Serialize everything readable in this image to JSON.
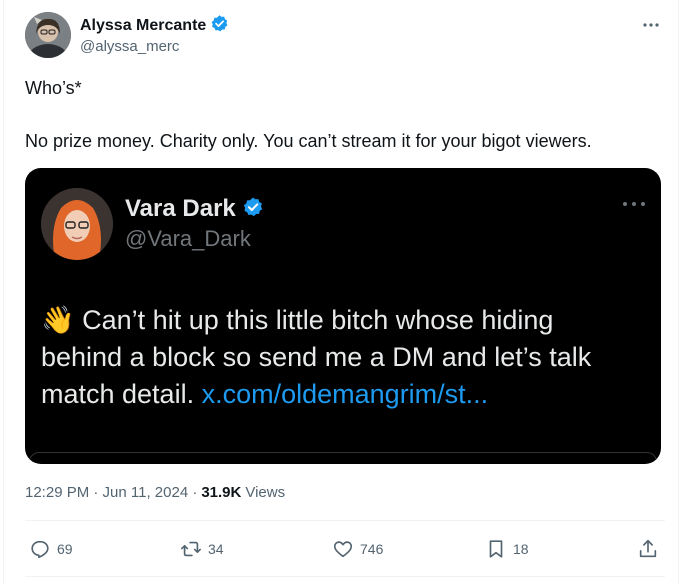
{
  "post": {
    "author": {
      "display_name": "Alyssa Mercante",
      "handle": "@alyssa_merc",
      "verified": true
    },
    "text_line1": "Who’s*",
    "text_line2": "No prize money. Charity only. You can’t stream it for your bigot viewers.",
    "quoted": {
      "author_name": "Vara Dark",
      "author_handle": "@Vara_Dark",
      "verified": true,
      "text_emoji": "👋",
      "text": "Can’t hit up this little bitch whose hiding behind a block so send me a DM and let’s talk match detail.",
      "link": "x.com/oldemangrim/st..."
    },
    "timestamp": "12:29 PM · Jun 11, 2024 ·",
    "views_count": "31.9K",
    "views_label": "Views",
    "actions": {
      "replies": "69",
      "reposts": "34",
      "likes": "746",
      "bookmarks": "18"
    }
  },
  "colors": {
    "verified_blue": "#1d9bf0",
    "text_primary": "#0f1419",
    "text_secondary": "#536471",
    "embed_background": "#000000"
  },
  "icons": [
    "verified-badge-icon",
    "more-icon",
    "reply-icon",
    "repost-icon",
    "like-icon",
    "bookmark-icon",
    "share-icon"
  ]
}
